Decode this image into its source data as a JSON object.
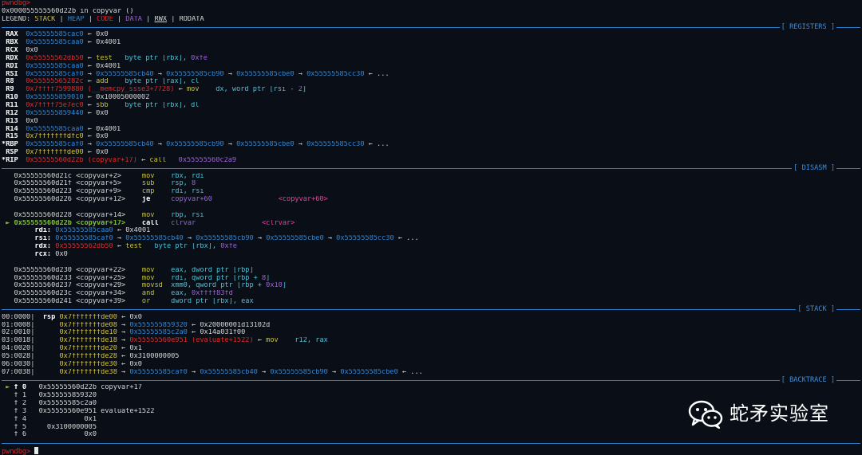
{
  "prompt": "pwndbg>",
  "header": {
    "location": "0x000055555560d22b in copyvar ()"
  },
  "legend": {
    "label": "LEGEND:",
    "items": [
      "STACK",
      "HEAP",
      "CODE",
      "DATA",
      "RWX",
      "RODATA"
    ]
  },
  "sections": {
    "registers": "[ REGISTERS ]",
    "disasm": "[ DISASM ]",
    "stack": "[ STACK ]",
    "backtrace": "[ BACKTRACE ]"
  },
  "registers": [
    {
      "name": "RAX",
      "prefix": " ",
      "segs": [
        {
          "t": "0x55555585cac0",
          "c": "heap"
        },
        {
          "t": " ← 0x0"
        }
      ]
    },
    {
      "name": "RBX",
      "prefix": " ",
      "segs": [
        {
          "t": "0x55555585caa0",
          "c": "heap"
        },
        {
          "t": " ← 0x4001"
        }
      ]
    },
    {
      "name": "RCX",
      "prefix": " ",
      "segs": [
        {
          "t": "0x0"
        }
      ]
    },
    {
      "name": "RDX",
      "prefix": " ",
      "segs": [
        {
          "t": "0x55555562db50",
          "c": "code"
        },
        {
          "t": " ← "
        },
        {
          "t": "test",
          "c": "ins"
        },
        {
          "t": "   byte ptr [rbx], ",
          "c": "cyan"
        },
        {
          "t": "0xfe",
          "c": "data"
        }
      ]
    },
    {
      "name": "RDI",
      "prefix": " ",
      "segs": [
        {
          "t": "0x55555585caa0",
          "c": "heap"
        },
        {
          "t": " ← 0x4001"
        }
      ]
    },
    {
      "name": "RSI",
      "prefix": " ",
      "segs": [
        {
          "t": "0x55555585caf0",
          "c": "heap"
        },
        {
          "t": " → "
        },
        {
          "t": "0x55555585cb40",
          "c": "heap"
        },
        {
          "t": " → "
        },
        {
          "t": "0x55555585cb90",
          "c": "heap"
        },
        {
          "t": " → "
        },
        {
          "t": "0x55555585cbe0",
          "c": "heap"
        },
        {
          "t": " → "
        },
        {
          "t": "0x55555585cc30",
          "c": "heap"
        },
        {
          "t": " ← ..."
        }
      ]
    },
    {
      "name": "R8",
      "prefix": " ",
      "segs": [
        {
          "t": "0x55555565282c",
          "c": "code"
        },
        {
          "t": " ← "
        },
        {
          "t": "add",
          "c": "ins"
        },
        {
          "t": "    byte ptr [rax], cl",
          "c": "cyan"
        }
      ]
    },
    {
      "name": "R9",
      "prefix": " ",
      "segs": [
        {
          "t": "0x7ffff7599880 (__memcpy_ssse3+7728)",
          "c": "code"
        },
        {
          "t": " ← "
        },
        {
          "t": "mov",
          "c": "ins"
        },
        {
          "t": "    dx, word ptr [rsi - ",
          "c": "cyan"
        },
        {
          "t": "2",
          "c": "data"
        },
        {
          "t": "]",
          "c": "cyan"
        }
      ]
    },
    {
      "name": "R10",
      "prefix": " ",
      "segs": [
        {
          "t": "0x555555859010",
          "c": "heap"
        },
        {
          "t": " ← 0x10005000002"
        }
      ]
    },
    {
      "name": "R11",
      "prefix": " ",
      "segs": [
        {
          "t": "0x7ffff75e7ec0",
          "c": "code"
        },
        {
          "t": " ← "
        },
        {
          "t": "sbb",
          "c": "ins"
        },
        {
          "t": "    byte ptr [rbx], dl",
          "c": "cyan"
        }
      ]
    },
    {
      "name": "R12",
      "prefix": " ",
      "segs": [
        {
          "t": "0x555555859440",
          "c": "heap"
        },
        {
          "t": " ← 0x0"
        }
      ]
    },
    {
      "name": "R13",
      "prefix": " ",
      "segs": [
        {
          "t": "0x0"
        }
      ]
    },
    {
      "name": "R14",
      "prefix": " ",
      "segs": [
        {
          "t": "0x55555585caa0",
          "c": "heap"
        },
        {
          "t": " ← 0x4001"
        }
      ]
    },
    {
      "name": "R15",
      "prefix": " ",
      "segs": [
        {
          "t": "0x7fffffffdfc0",
          "c": "stack"
        },
        {
          "t": " ← 0x0"
        }
      ]
    },
    {
      "name": "RBP",
      "prefix": "*",
      "segs": [
        {
          "t": "0x55555585caf0",
          "c": "heap"
        },
        {
          "t": " → "
        },
        {
          "t": "0x55555585cb40",
          "c": "heap"
        },
        {
          "t": " → "
        },
        {
          "t": "0x55555585cb90",
          "c": "heap"
        },
        {
          "t": " → "
        },
        {
          "t": "0x55555585cbe0",
          "c": "heap"
        },
        {
          "t": " → "
        },
        {
          "t": "0x55555585cc30",
          "c": "heap"
        },
        {
          "t": " ← ..."
        }
      ]
    },
    {
      "name": "RSP",
      "prefix": " ",
      "segs": [
        {
          "t": "0x7fffffffde00",
          "c": "stack"
        },
        {
          "t": " ← 0x0"
        }
      ]
    },
    {
      "name": "RIP",
      "prefix": "*",
      "segs": [
        {
          "t": "0x55555560d22b (copyvar+17)",
          "c": "code"
        },
        {
          "t": " ← "
        },
        {
          "t": "call",
          "c": "ins"
        },
        {
          "t": "   "
        },
        {
          "t": "0x55555560c2a9",
          "c": "data"
        }
      ]
    }
  ],
  "disasm": [
    {
      "segs": [
        {
          "t": "   0x55555560d21c <copyvar+2>     "
        },
        {
          "t": "mov",
          "c": "ins"
        },
        {
          "t": "    rbx, rdi",
          "c": "cyan"
        }
      ]
    },
    {
      "segs": [
        {
          "t": "   0x55555560d21f <copyvar+5>     "
        },
        {
          "t": "sub",
          "c": "ins"
        },
        {
          "t": "    rsp, ",
          "c": "cyan"
        },
        {
          "t": "8",
          "c": "data"
        }
      ]
    },
    {
      "segs": [
        {
          "t": "   0x55555560d223 <copyvar+9>     "
        },
        {
          "t": "cmp",
          "c": "ins"
        },
        {
          "t": "    rdi, rsi",
          "c": "cyan"
        }
      ]
    },
    {
      "segs": [
        {
          "t": "   0x55555560d226 <copyvar+12>    "
        },
        {
          "t": "je",
          "c": "ins",
          "b": true
        },
        {
          "t": "     copyvar+60",
          "c": "data"
        },
        {
          "t": "                "
        },
        {
          "t": "<copyvar+60>",
          "c": "pink"
        }
      ]
    },
    {
      "segs": [
        {
          "t": " "
        }
      ]
    },
    {
      "segs": [
        {
          "t": "   0x55555560d228 <copyvar+14>    "
        },
        {
          "t": "mov",
          "c": "ins"
        },
        {
          "t": "    rbp, rsi",
          "c": "cyan"
        }
      ]
    },
    {
      "segs": [
        {
          "t": " ► ",
          "c": "cur"
        },
        {
          "t": "0x55555560d22b <copyvar+17>    ",
          "c": "cur"
        },
        {
          "t": "call",
          "c": "ins",
          "b": true
        },
        {
          "t": "   clrvar",
          "c": "data"
        },
        {
          "t": "                "
        },
        {
          "t": "<clrvar>",
          "c": "pink"
        }
      ]
    },
    {
      "segs": [
        {
          "t": "        "
        },
        {
          "t": "rdi:",
          "b": true
        },
        {
          "t": " "
        },
        {
          "t": "0x55555585caa0",
          "c": "heap"
        },
        {
          "t": " ← 0x4001"
        }
      ]
    },
    {
      "segs": [
        {
          "t": "        "
        },
        {
          "t": "rsi:",
          "b": true
        },
        {
          "t": " "
        },
        {
          "t": "0x55555585caf0",
          "c": "heap"
        },
        {
          "t": " → "
        },
        {
          "t": "0x55555585cb40",
          "c": "heap"
        },
        {
          "t": " → "
        },
        {
          "t": "0x55555585cb90",
          "c": "heap"
        },
        {
          "t": " → "
        },
        {
          "t": "0x55555585cbe0",
          "c": "heap"
        },
        {
          "t": " → "
        },
        {
          "t": "0x55555585cc30",
          "c": "heap"
        },
        {
          "t": " ← ..."
        }
      ]
    },
    {
      "segs": [
        {
          "t": "        "
        },
        {
          "t": "rdx:",
          "b": true
        },
        {
          "t": " "
        },
        {
          "t": "0x55555562db50",
          "c": "code"
        },
        {
          "t": " ← "
        },
        {
          "t": "test",
          "c": "ins"
        },
        {
          "t": "   byte ptr [rbx], ",
          "c": "cyan"
        },
        {
          "t": "0xfe",
          "c": "data"
        }
      ]
    },
    {
      "segs": [
        {
          "t": "        "
        },
        {
          "t": "rcx:",
          "b": true
        },
        {
          "t": " 0x0"
        }
      ]
    },
    {
      "segs": [
        {
          "t": " "
        }
      ]
    },
    {
      "segs": [
        {
          "t": "   0x55555560d230 <copyvar+22>    "
        },
        {
          "t": "mov",
          "c": "ins"
        },
        {
          "t": "    eax, dword ptr [rbp]",
          "c": "cyan"
        }
      ]
    },
    {
      "segs": [
        {
          "t": "   0x55555560d233 <copyvar+25>    "
        },
        {
          "t": "mov",
          "c": "ins"
        },
        {
          "t": "    rdi, qword ptr [rbp + ",
          "c": "cyan"
        },
        {
          "t": "8",
          "c": "data"
        },
        {
          "t": "]",
          "c": "cyan"
        }
      ]
    },
    {
      "segs": [
        {
          "t": "   0x55555560d237 <copyvar+29>    "
        },
        {
          "t": "movsd",
          "c": "ins"
        },
        {
          "t": "  xmm0, qword ptr [rbp + ",
          "c": "cyan"
        },
        {
          "t": "0x10",
          "c": "data"
        },
        {
          "t": "]",
          "c": "cyan"
        }
      ]
    },
    {
      "segs": [
        {
          "t": "   0x55555560d23c <copyvar+34>    "
        },
        {
          "t": "and",
          "c": "ins"
        },
        {
          "t": "    eax, ",
          "c": "cyan"
        },
        {
          "t": "0xffff83fd",
          "c": "data"
        }
      ]
    },
    {
      "segs": [
        {
          "t": "   0x55555560d241 <copyvar+39>    "
        },
        {
          "t": "or",
          "c": "ins"
        },
        {
          "t": "     dword ptr [rbx], eax",
          "c": "cyan"
        }
      ]
    }
  ],
  "stack": [
    {
      "segs": [
        {
          "t": "00:0000│  "
        },
        {
          "t": "rsp",
          "b": true
        },
        {
          "t": " "
        },
        {
          "t": "0x7fffffffde00",
          "c": "stack"
        },
        {
          "t": " ← 0x0"
        }
      ]
    },
    {
      "segs": [
        {
          "t": "01:0008│      "
        },
        {
          "t": "0x7fffffffde08",
          "c": "stack"
        },
        {
          "t": " → "
        },
        {
          "t": "0x555555859320",
          "c": "heap"
        },
        {
          "t": " ← 0x20000001d13102d"
        }
      ]
    },
    {
      "segs": [
        {
          "t": "02:0010│      "
        },
        {
          "t": "0x7fffffffde10",
          "c": "stack"
        },
        {
          "t": " → "
        },
        {
          "t": "0x55555585c2a0",
          "c": "heap"
        },
        {
          "t": " ← 0x14a031f00"
        }
      ]
    },
    {
      "segs": [
        {
          "t": "03:0018│      "
        },
        {
          "t": "0x7fffffffde18",
          "c": "stack"
        },
        {
          "t": " → "
        },
        {
          "t": "0x55555560e951 (evaluate+1522)",
          "c": "code"
        },
        {
          "t": " ← "
        },
        {
          "t": "mov",
          "c": "ins"
        },
        {
          "t": "    r12, rax",
          "c": "cyan"
        }
      ]
    },
    {
      "segs": [
        {
          "t": "04:0020│      "
        },
        {
          "t": "0x7fffffffde20",
          "c": "stack"
        },
        {
          "t": " ← 0x1"
        }
      ]
    },
    {
      "segs": [
        {
          "t": "05:0028│      "
        },
        {
          "t": "0x7fffffffde28",
          "c": "stack"
        },
        {
          "t": " ← 0x3100000005"
        }
      ]
    },
    {
      "segs": [
        {
          "t": "06:0030│      "
        },
        {
          "t": "0x7fffffffde30",
          "c": "stack"
        },
        {
          "t": " ← 0x0"
        }
      ]
    },
    {
      "segs": [
        {
          "t": "07:0038│      "
        },
        {
          "t": "0x7fffffffde38",
          "c": "stack"
        },
        {
          "t": " → "
        },
        {
          "t": "0x55555585caf0",
          "c": "heap"
        },
        {
          "t": " → "
        },
        {
          "t": "0x55555585cb40",
          "c": "heap"
        },
        {
          "t": " → "
        },
        {
          "t": "0x55555585cb90",
          "c": "heap"
        },
        {
          "t": " → "
        },
        {
          "t": "0x55555585cbe0",
          "c": "heap"
        },
        {
          "t": " ← ..."
        }
      ]
    }
  ],
  "backtrace": [
    {
      "segs": [
        {
          "t": " ► ",
          "c": "cur"
        },
        {
          "t": "f 0",
          "b": true
        },
        {
          "t": "   0x55555560d22b copyvar+17"
        }
      ]
    },
    {
      "segs": [
        {
          "t": "   f 1   0x555555859320"
        }
      ]
    },
    {
      "segs": [
        {
          "t": "   f 2   0x55555585c2a0"
        }
      ]
    },
    {
      "segs": [
        {
          "t": "   f 3   0x55555560e951 evaluate+1522"
        }
      ]
    },
    {
      "segs": [
        {
          "t": "   f 4              0x1"
        }
      ]
    },
    {
      "segs": [
        {
          "t": "   f 5     0x3100000005"
        }
      ]
    },
    {
      "segs": [
        {
          "t": "   f 6              0x0"
        }
      ]
    }
  ],
  "watermark": {
    "text": "蛇矛实验室",
    "icon": "wechat-icon"
  },
  "colors": {
    "background": "#0a0f17",
    "stack": "#d6c23a",
    "heap": "#2f86d6",
    "code": "#e02a2a",
    "data": "#9b64d8",
    "instruction": "#c7c43a",
    "operand": "#4cc2d8",
    "separator": "#2b7ac9"
  }
}
